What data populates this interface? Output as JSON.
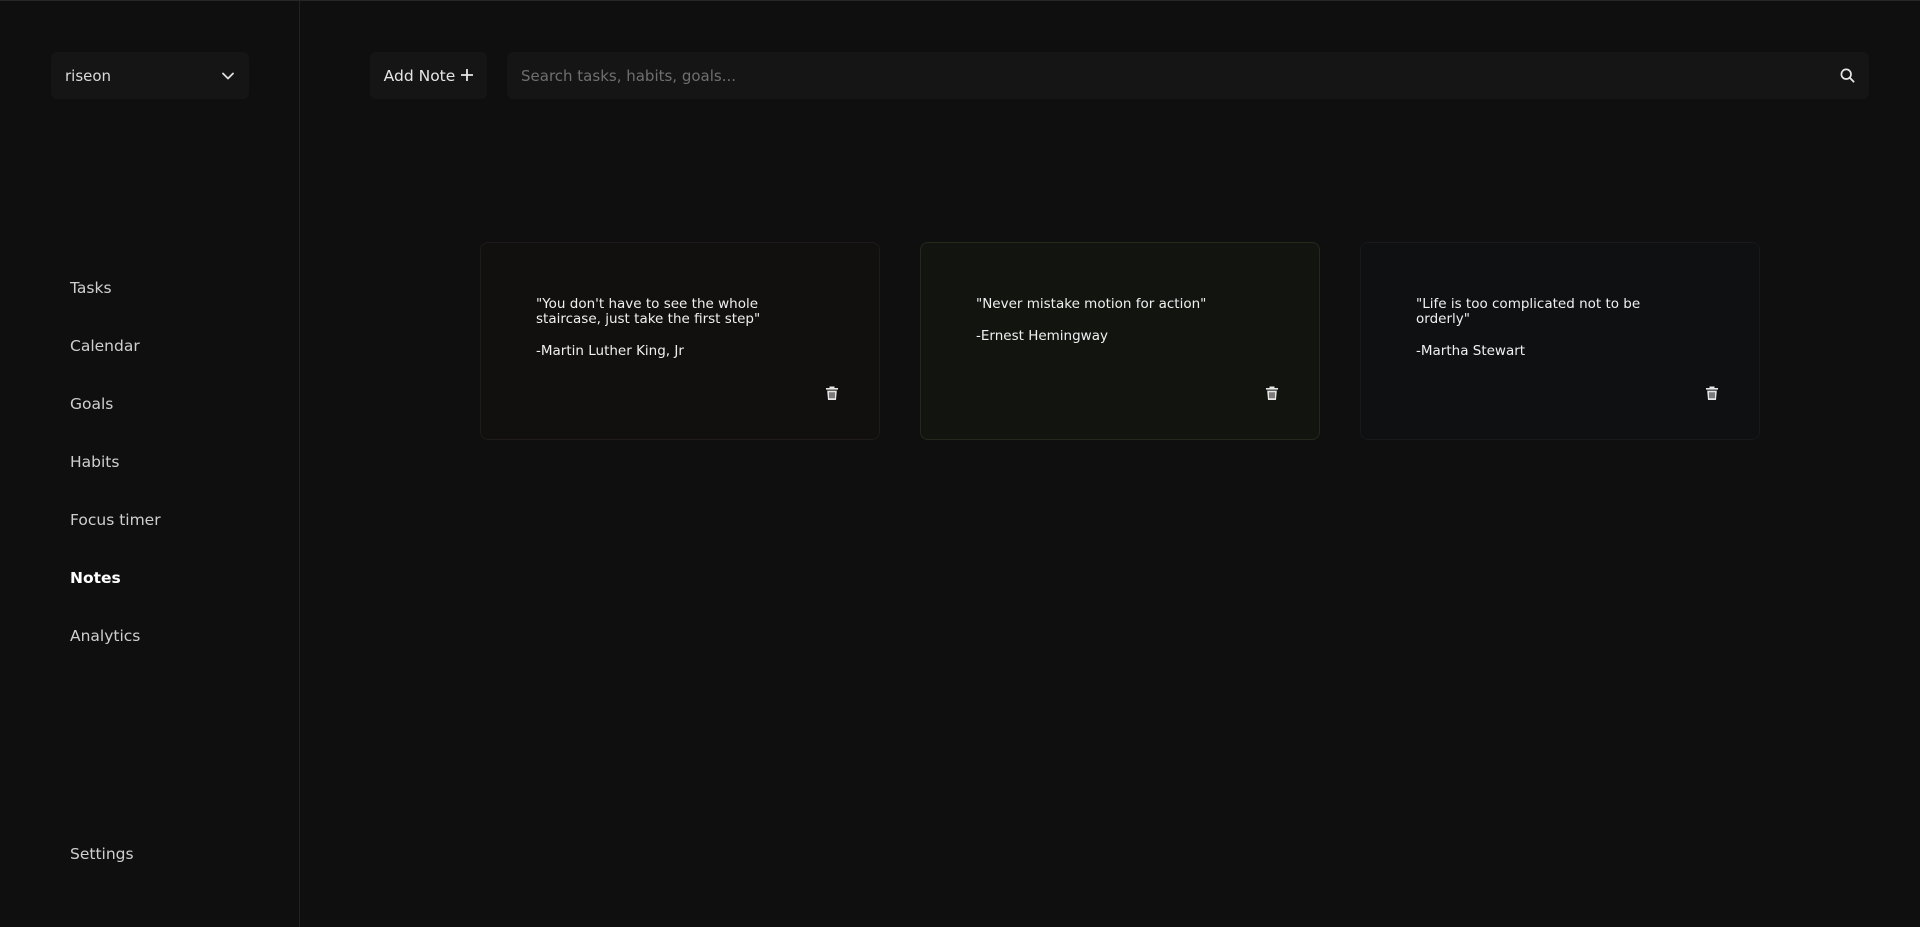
{
  "workspace": {
    "name": "riseon",
    "dropdown_icon": "chevron-down-icon"
  },
  "sidebar": {
    "items": [
      {
        "label": "Tasks"
      },
      {
        "label": "Calendar"
      },
      {
        "label": "Goals"
      },
      {
        "label": "Habits"
      },
      {
        "label": "Focus timer"
      },
      {
        "label": "Notes",
        "active": true
      },
      {
        "label": "Analytics"
      }
    ],
    "settings_label": "Settings"
  },
  "toolbar": {
    "add_note_label": "Add Note",
    "add_icon": "plus-icon"
  },
  "search": {
    "placeholder": "Search tasks, habits, goals...",
    "value": "",
    "icon": "search-icon"
  },
  "notes": [
    {
      "quote": "\"You don't have to see the whole staircase, just take the first step\"",
      "author": "-Martin Luther King, Jr",
      "bg": "#120f0f",
      "border": "#201a1a"
    },
    {
      "quote": "\"Never mistake motion for action\"",
      "author": "-Ernest Hemingway",
      "bg": "#121410",
      "border": "#232a1c"
    },
    {
      "quote": "\"Life is too complicated not to be orderly\"",
      "author": "-Martha Stewart",
      "bg": "#0f1012",
      "border": "#18191c"
    }
  ],
  "colors": {
    "background": "#0f0f0f",
    "panel": "#151515",
    "text": "#e6e6e6",
    "muted": "#6f6f6f"
  }
}
